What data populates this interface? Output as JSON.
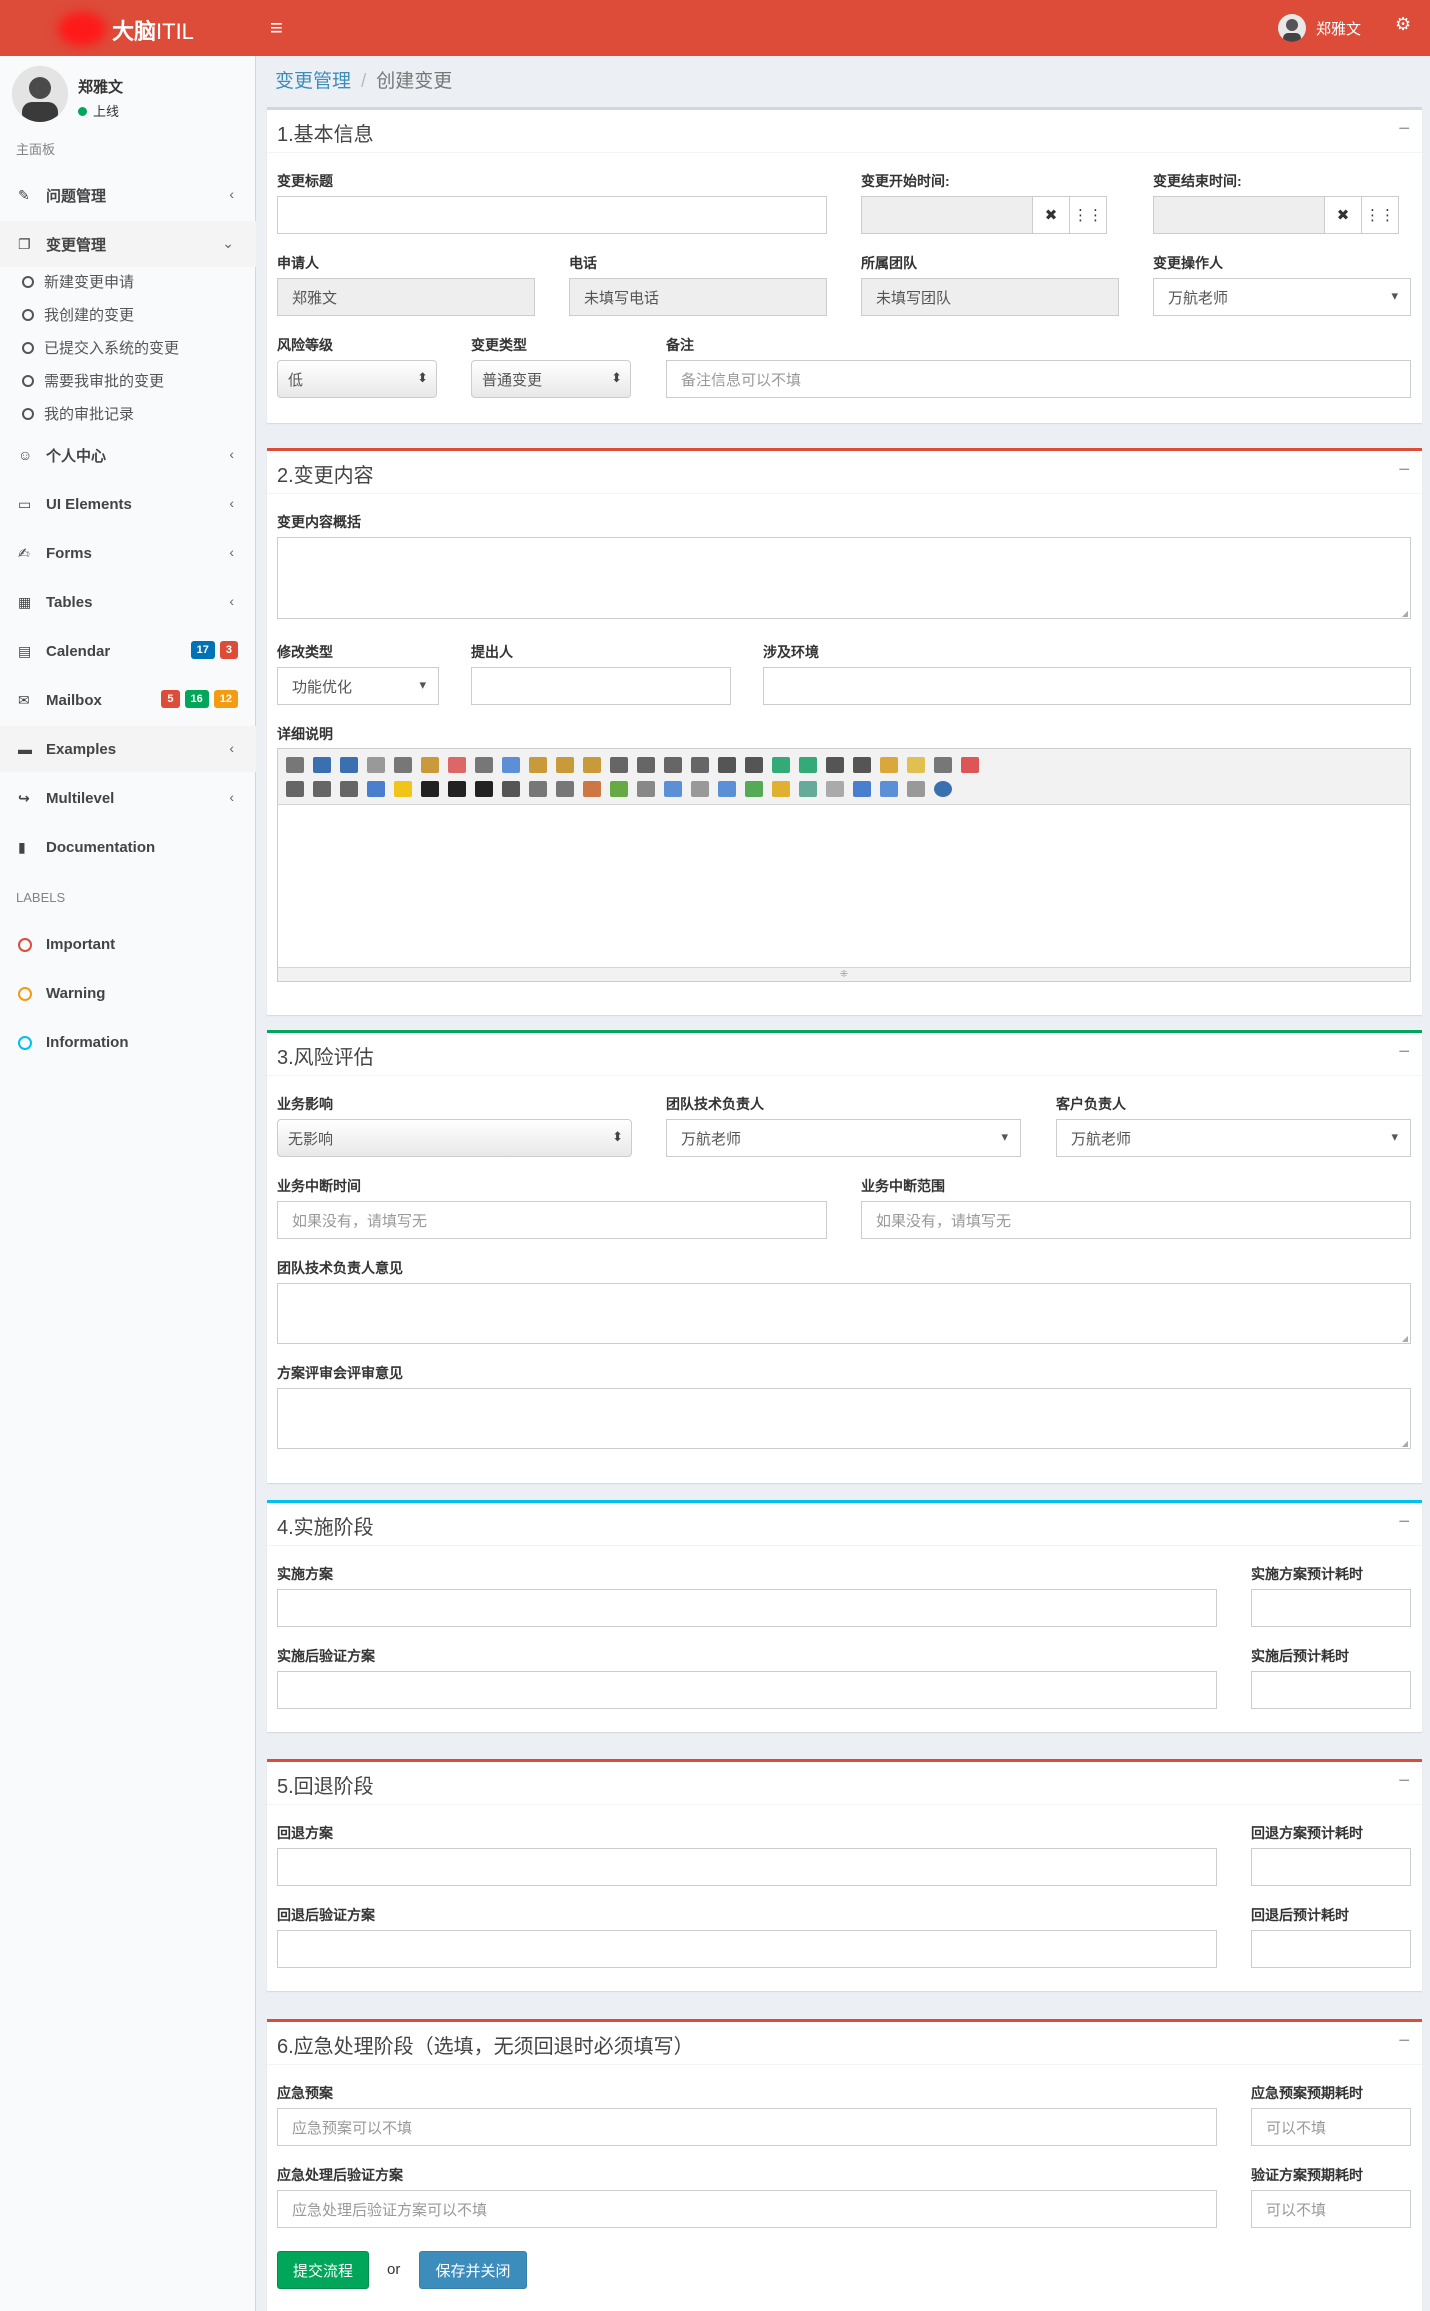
{
  "header": {
    "logo_main": "大脑",
    "logo_suffix": "ITIL",
    "menu_icon": "bars-icon",
    "user_name": "郑雅文",
    "settings_icon": "gears-icon"
  },
  "sidebar": {
    "user_name": "郑雅文",
    "status": "上线",
    "main_header": "主面板",
    "items": [
      {
        "label": "问题管理",
        "icon": "pencil-icon"
      },
      {
        "label": "变更管理",
        "icon": "copy-icon"
      },
      {
        "label": "个人中心",
        "icon": "smile-icon"
      },
      {
        "label": "UI Elements",
        "icon": "laptop-icon"
      },
      {
        "label": "Forms",
        "icon": "edit-icon"
      },
      {
        "label": "Tables",
        "icon": "table-icon"
      },
      {
        "label": "Calendar",
        "icon": "calendar-icon",
        "badges": [
          "17",
          "3"
        ]
      },
      {
        "label": "Mailbox",
        "icon": "envelope-icon",
        "badges": [
          "5",
          "16",
          "12"
        ]
      },
      {
        "label": "Examples",
        "icon": "folder-icon"
      },
      {
        "label": "Multilevel",
        "icon": "share-icon"
      },
      {
        "label": "Documentation",
        "icon": "book-icon"
      }
    ],
    "submenu": [
      "新建变更申请",
      "我创建的变更",
      "已提交入系统的变更",
      "需要我审批的变更",
      "我的审批记录"
    ],
    "labels_header": "LABELS",
    "labels": [
      {
        "label": "Important",
        "color": "#dd4b39"
      },
      {
        "label": "Warning",
        "color": "#f39c12"
      },
      {
        "label": "Information",
        "color": "#00c0ef"
      }
    ]
  },
  "breadcrumb": {
    "parent": "变更管理",
    "current": "创建变更"
  },
  "sections": {
    "basic": {
      "title": "1.基本信息",
      "change_title_label": "变更标题",
      "start_time_label": "变更开始时间:",
      "end_time_label": "变更结束时间:",
      "applicant_label": "申请人",
      "applicant_value": "郑雅文",
      "phone_label": "电话",
      "phone_value": "未填写电话",
      "team_label": "所属团队",
      "team_value": "未填写团队",
      "operator_label": "变更操作人",
      "operator_value": "万航老师",
      "risk_label": "风险等级",
      "risk_value": "低",
      "type_label": "变更类型",
      "type_value": "普通变更",
      "remark_label": "备注",
      "remark_placeholder": "备注信息可以不填"
    },
    "content": {
      "title": "2.变更内容",
      "summary_label": "变更内容概括",
      "modify_type_label": "修改类型",
      "modify_type_value": "功能优化",
      "proposer_label": "提出人",
      "env_label": "涉及环境",
      "detail_label": "详细说明"
    },
    "risk": {
      "title": "3.风险评估",
      "impact_label": "业务影响",
      "impact_value": "无影响",
      "tech_lead_label": "团队技术负责人",
      "tech_lead_value": "万航老师",
      "customer_label": "客户负责人",
      "customer_value": "万航老师",
      "interrupt_time_label": "业务中断时间",
      "interrupt_time_placeholder": "如果没有，请填写无",
      "interrupt_scope_label": "业务中断范围",
      "interrupt_scope_placeholder": "如果没有，请填写无",
      "lead_opinion_label": "团队技术负责人意见",
      "review_opinion_label": "方案评审会评审意见"
    },
    "impl": {
      "title": "4.实施阶段",
      "plan_label": "实施方案",
      "plan_time_label": "实施方案预计耗时",
      "verify_label": "实施后验证方案",
      "verify_time_label": "实施后预计耗时"
    },
    "rollback": {
      "title": "5.回退阶段",
      "plan_label": "回退方案",
      "plan_time_label": "回退方案预计耗时",
      "verify_label": "回退后验证方案",
      "verify_time_label": "回退后预计耗时"
    },
    "emergency": {
      "title": "6.应急处理阶段（选填，无须回退时必须填写）",
      "plan_label": "应急预案",
      "plan_placeholder": "应急预案可以不填",
      "plan_time_label": "应急预案预期耗时",
      "plan_time_placeholder": "可以不填",
      "verify_label": "应急处理后验证方案",
      "verify_placeholder": "应急处理后验证方案可以不填",
      "verify_time_label": "验证方案预期耗时",
      "verify_time_placeholder": "可以不填"
    }
  },
  "actions": {
    "submit": "提交流程",
    "or": "or",
    "save_close": "保存并关闭"
  },
  "collapse_symbol": "−"
}
